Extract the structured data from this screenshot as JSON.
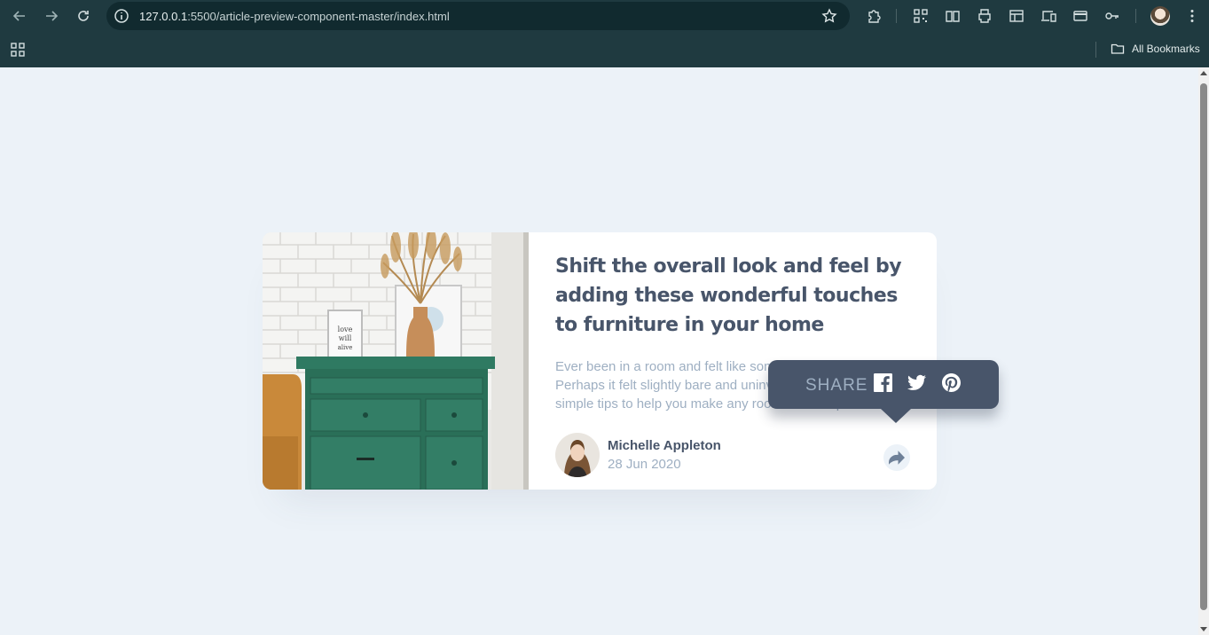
{
  "browser": {
    "url_host": "127.0.0.1",
    "url_path": ":5500/article-preview-component-master/index.html",
    "bookmarks_label": "All Bookmarks"
  },
  "article": {
    "title": "Shift the overall look and feel by adding these wonderful touches to furniture in your home",
    "description": "Ever been in a room and felt like something was missing? Perhaps it felt slightly bare and uninviting. I’ve got some simple tips to help you make any room feel complete.",
    "author_name": "Michelle Appleton",
    "date": "28 Jun 2020"
  },
  "share": {
    "label": "SHARE",
    "icons": [
      "facebook-icon",
      "twitter-icon",
      "pinterest-icon"
    ]
  },
  "colors": {
    "page_bg": "#ecf2f8",
    "title": "#48556a",
    "muted": "#9eafc2",
    "tooltip_bg": "#48556a",
    "chrome_bg": "#1f3a40"
  }
}
